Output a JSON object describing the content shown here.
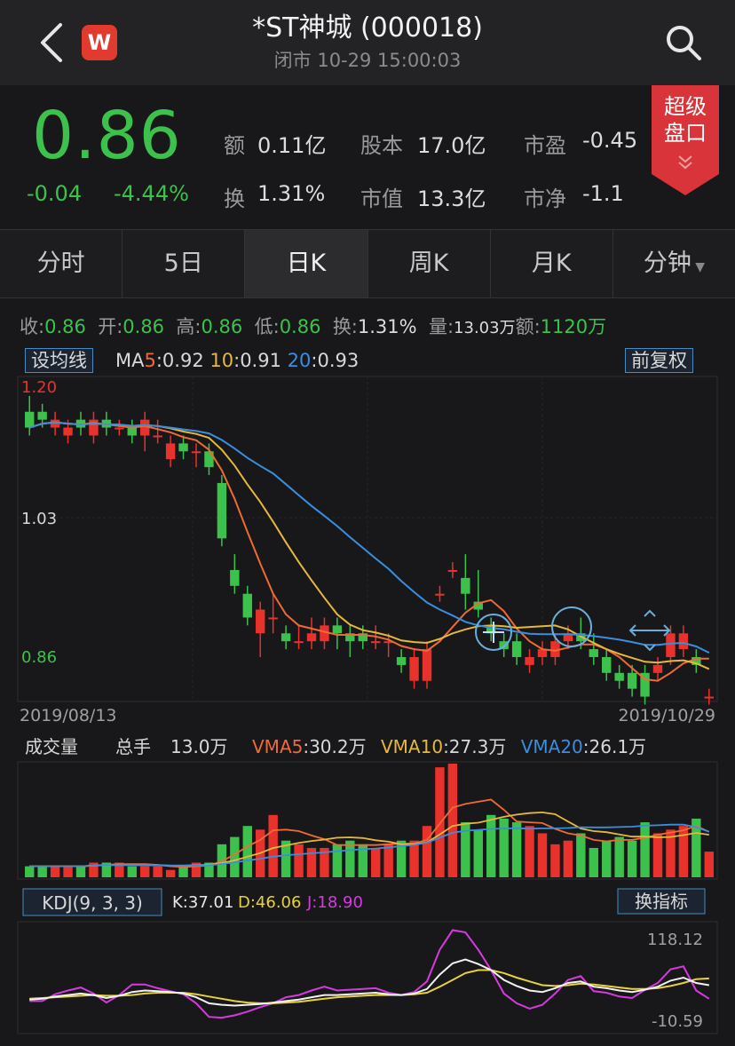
{
  "header": {
    "title": "*ST神城 (000018)",
    "subtitle": "闭市 10-29 15:00:03",
    "logo_letter": "W"
  },
  "quote": {
    "price": "0.86",
    "change": "-0.04",
    "change_pct": "-4.44%",
    "fields": [
      {
        "label": "额",
        "value": "0.11亿"
      },
      {
        "label": "股本",
        "value": "17.0亿"
      },
      {
        "label": "市盈",
        "value": "-0.45"
      },
      {
        "label": "换",
        "value": "1.31%"
      },
      {
        "label": "市值",
        "value": "13.3亿"
      },
      {
        "label": "市净",
        "value": "-1.1"
      }
    ],
    "super_button": {
      "line1": "超级",
      "line2": "盘口"
    }
  },
  "tabs": [
    {
      "label": "分时",
      "active": false
    },
    {
      "label": "5日",
      "active": false
    },
    {
      "label": "日K",
      "active": true
    },
    {
      "label": "周K",
      "active": false
    },
    {
      "label": "月K",
      "active": false
    },
    {
      "label": "分钟",
      "active": false,
      "dropdown": true
    }
  ],
  "ohlc": [
    {
      "label": "收:",
      "value": "0.86",
      "green": true
    },
    {
      "label": "开:",
      "value": "0.86",
      "green": true
    },
    {
      "label": "高:",
      "value": "0.86",
      "green": true
    },
    {
      "label": "低:",
      "value": "0.86",
      "green": true
    },
    {
      "label": "换:",
      "value": "1.31%",
      "green": false
    },
    {
      "label": "量:",
      "value": "13.03万",
      "green": false
    },
    {
      "label": "额:",
      "value": "1120万",
      "green": true
    }
  ],
  "kline": {
    "ma_button": "设均线",
    "ma_label": "MA",
    "ma": [
      {
        "n": "5",
        "val": ":0.92",
        "color": "#f06a36"
      },
      {
        "n": "10",
        "val": ":0.91",
        "color": "#e6b83a"
      },
      {
        "n": "20",
        "val": ":0.93",
        "color": "#3a8ee0"
      }
    ],
    "adjust_button": "前复权",
    "y_labels": {
      "top": "1.20",
      "mid": "1.03",
      "bottom": "0.86"
    },
    "date_start": "2019/08/13",
    "date_end": "2019/10/29"
  },
  "volume": {
    "title": "成交量",
    "total_label": "总手",
    "total_value": "13.0万",
    "vma": [
      {
        "name": "VMA5",
        "val": ":30.2万",
        "color": "#f06a36"
      },
      {
        "name": "VMA10",
        "val": ":27.3万",
        "color": "#e6b83a"
      },
      {
        "name": "VMA20",
        "val": ":26.1万",
        "color": "#3a8ee0"
      }
    ]
  },
  "kdj": {
    "button": "KDJ(9, 3, 3)",
    "k": "K:37.01",
    "d": "D:46.06",
    "j": "J:18.90",
    "switch_button": "换指标",
    "max_label": "118.12",
    "min_label": "-10.59"
  },
  "colors": {
    "up": "#e8322b",
    "down": "#3cc24c",
    "accent": "#4a8bbf"
  },
  "chart_data": {
    "type": "candlestick",
    "x_start": "2019/08/13",
    "x_end": "2019/10/29",
    "candles": [
      {
        "o": 1.17,
        "c": 1.15,
        "h": 1.19,
        "l": 1.14
      },
      {
        "o": 1.17,
        "c": 1.16,
        "h": 1.18,
        "l": 1.15
      },
      {
        "o": 1.15,
        "c": 1.16,
        "h": 1.17,
        "l": 1.14
      },
      {
        "o": 1.14,
        "c": 1.15,
        "h": 1.16,
        "l": 1.13
      },
      {
        "o": 1.16,
        "c": 1.15,
        "h": 1.17,
        "l": 1.14
      },
      {
        "o": 1.14,
        "c": 1.16,
        "h": 1.17,
        "l": 1.13
      },
      {
        "o": 1.16,
        "c": 1.15,
        "h": 1.17,
        "l": 1.14
      },
      {
        "o": 1.15,
        "c": 1.15,
        "h": 1.16,
        "l": 1.14
      },
      {
        "o": 1.15,
        "c": 1.14,
        "h": 1.16,
        "l": 1.13
      },
      {
        "o": 1.14,
        "c": 1.16,
        "h": 1.17,
        "l": 1.12
      },
      {
        "o": 1.14,
        "c": 1.14,
        "h": 1.16,
        "l": 1.13
      },
      {
        "o": 1.11,
        "c": 1.13,
        "h": 1.14,
        "l": 1.1
      },
      {
        "o": 1.13,
        "c": 1.12,
        "h": 1.14,
        "l": 1.11
      },
      {
        "o": 1.12,
        "c": 1.12,
        "h": 1.13,
        "l": 1.1
      },
      {
        "o": 1.12,
        "c": 1.1,
        "h": 1.13,
        "l": 1.09
      },
      {
        "o": 1.08,
        "c": 1.01,
        "h": 1.09,
        "l": 1.0
      },
      {
        "o": 0.97,
        "c": 0.95,
        "h": 0.99,
        "l": 0.94
      },
      {
        "o": 0.94,
        "c": 0.91,
        "h": 0.95,
        "l": 0.9
      },
      {
        "o": 0.89,
        "c": 0.92,
        "h": 0.93,
        "l": 0.86
      },
      {
        "o": 0.91,
        "c": 0.91,
        "h": 0.94,
        "l": 0.89
      },
      {
        "o": 0.89,
        "c": 0.88,
        "h": 0.9,
        "l": 0.87
      },
      {
        "o": 0.88,
        "c": 0.88,
        "h": 0.9,
        "l": 0.87
      },
      {
        "o": 0.88,
        "c": 0.89,
        "h": 0.91,
        "l": 0.87
      },
      {
        "o": 0.88,
        "c": 0.9,
        "h": 0.91,
        "l": 0.87
      },
      {
        "o": 0.9,
        "c": 0.89,
        "h": 0.91,
        "l": 0.87
      },
      {
        "o": 0.89,
        "c": 0.88,
        "h": 0.9,
        "l": 0.86
      },
      {
        "o": 0.89,
        "c": 0.88,
        "h": 0.9,
        "l": 0.87
      },
      {
        "o": 0.88,
        "c": 0.88,
        "h": 0.9,
        "l": 0.87
      },
      {
        "o": 0.88,
        "c": 0.88,
        "h": 0.89,
        "l": 0.86
      },
      {
        "o": 0.86,
        "c": 0.85,
        "h": 0.87,
        "l": 0.84
      },
      {
        "o": 0.83,
        "c": 0.86,
        "h": 0.87,
        "l": 0.82
      },
      {
        "o": 0.83,
        "c": 0.87,
        "h": 0.88,
        "l": 0.82
      },
      {
        "o": 0.94,
        "c": 0.94,
        "h": 0.95,
        "l": 0.93
      },
      {
        "o": 0.97,
        "c": 0.97,
        "h": 0.98,
        "l": 0.96
      },
      {
        "o": 0.96,
        "c": 0.94,
        "h": 0.99,
        "l": 0.92
      },
      {
        "o": 0.93,
        "c": 0.92,
        "h": 0.97,
        "l": 0.91
      },
      {
        "o": 0.9,
        "c": 0.89,
        "h": 0.91,
        "l": 0.88
      },
      {
        "o": 0.88,
        "c": 0.87,
        "h": 0.89,
        "l": 0.86
      },
      {
        "o": 0.88,
        "c": 0.86,
        "h": 0.89,
        "l": 0.85
      },
      {
        "o": 0.85,
        "c": 0.86,
        "h": 0.87,
        "l": 0.84
      },
      {
        "o": 0.86,
        "c": 0.87,
        "h": 0.88,
        "l": 0.85
      },
      {
        "o": 0.86,
        "c": 0.88,
        "h": 0.89,
        "l": 0.85
      },
      {
        "o": 0.88,
        "c": 0.89,
        "h": 0.9,
        "l": 0.87
      },
      {
        "o": 0.89,
        "c": 0.88,
        "h": 0.91,
        "l": 0.87
      },
      {
        "o": 0.87,
        "c": 0.86,
        "h": 0.89,
        "l": 0.85
      },
      {
        "o": 0.86,
        "c": 0.84,
        "h": 0.87,
        "l": 0.83
      },
      {
        "o": 0.84,
        "c": 0.83,
        "h": 0.85,
        "l": 0.82
      },
      {
        "o": 0.84,
        "c": 0.82,
        "h": 0.85,
        "l": 0.81
      },
      {
        "o": 0.84,
        "c": 0.81,
        "h": 0.85,
        "l": 0.8
      },
      {
        "o": 0.84,
        "c": 0.85,
        "h": 0.86,
        "l": 0.83
      },
      {
        "o": 0.86,
        "c": 0.89,
        "h": 0.9,
        "l": 0.85
      },
      {
        "o": 0.87,
        "c": 0.89,
        "h": 0.9,
        "l": 0.86
      },
      {
        "o": 0.86,
        "c": 0.85,
        "h": 0.87,
        "l": 0.84
      },
      {
        "o": 0.81,
        "c": 0.81,
        "h": 0.82,
        "l": 0.8
      }
    ],
    "volume": [
      3,
      3,
      3,
      3,
      3,
      4,
      4,
      4,
      3,
      3,
      3,
      2,
      3,
      4,
      4,
      9,
      11,
      14,
      13,
      17,
      10,
      9,
      8,
      8,
      9,
      10,
      9,
      8,
      9,
      10,
      10,
      14,
      30,
      31,
      15,
      13,
      17,
      16,
      15,
      14,
      12,
      9,
      10,
      12,
      8,
      10,
      11,
      10,
      15,
      12,
      13,
      14,
      16,
      7
    ],
    "kdj": {
      "K": [
        18,
        19,
        22,
        24,
        26,
        24,
        20,
        23,
        28,
        30,
        29,
        28,
        26,
        21,
        13,
        11,
        10,
        11,
        12,
        14,
        16,
        18,
        21,
        24,
        24,
        25,
        26,
        27,
        25,
        24,
        26,
        32,
        51,
        66,
        71,
        65,
        57,
        44,
        36,
        30,
        28,
        33,
        40,
        42,
        35,
        33,
        30,
        28,
        31,
        35,
        43,
        47,
        40,
        37
      ],
      "D": [
        19,
        20,
        21,
        22,
        23,
        24,
        23,
        23,
        24,
        26,
        27,
        27,
        27,
        25,
        22,
        19,
        16,
        14,
        13,
        13,
        14,
        15,
        17,
        19,
        21,
        22,
        23,
        24,
        24,
        24,
        25,
        27,
        35,
        44,
        53,
        57,
        57,
        53,
        47,
        42,
        37,
        36,
        37,
        39,
        38,
        36,
        34,
        32,
        32,
        33,
        36,
        40,
        45,
        46
      ],
      "J": [
        16,
        16,
        25,
        30,
        34,
        26,
        14,
        24,
        38,
        38,
        33,
        29,
        25,
        13,
        -5,
        -6,
        -3,
        2,
        8,
        13,
        21,
        24,
        30,
        35,
        30,
        31,
        32,
        33,
        27,
        24,
        28,
        42,
        84,
        110,
        107,
        84,
        57,
        26,
        13,
        6,
        11,
        26,
        44,
        49,
        29,
        27,
        22,
        20,
        31,
        40,
        58,
        62,
        30,
        19
      ]
    }
  }
}
